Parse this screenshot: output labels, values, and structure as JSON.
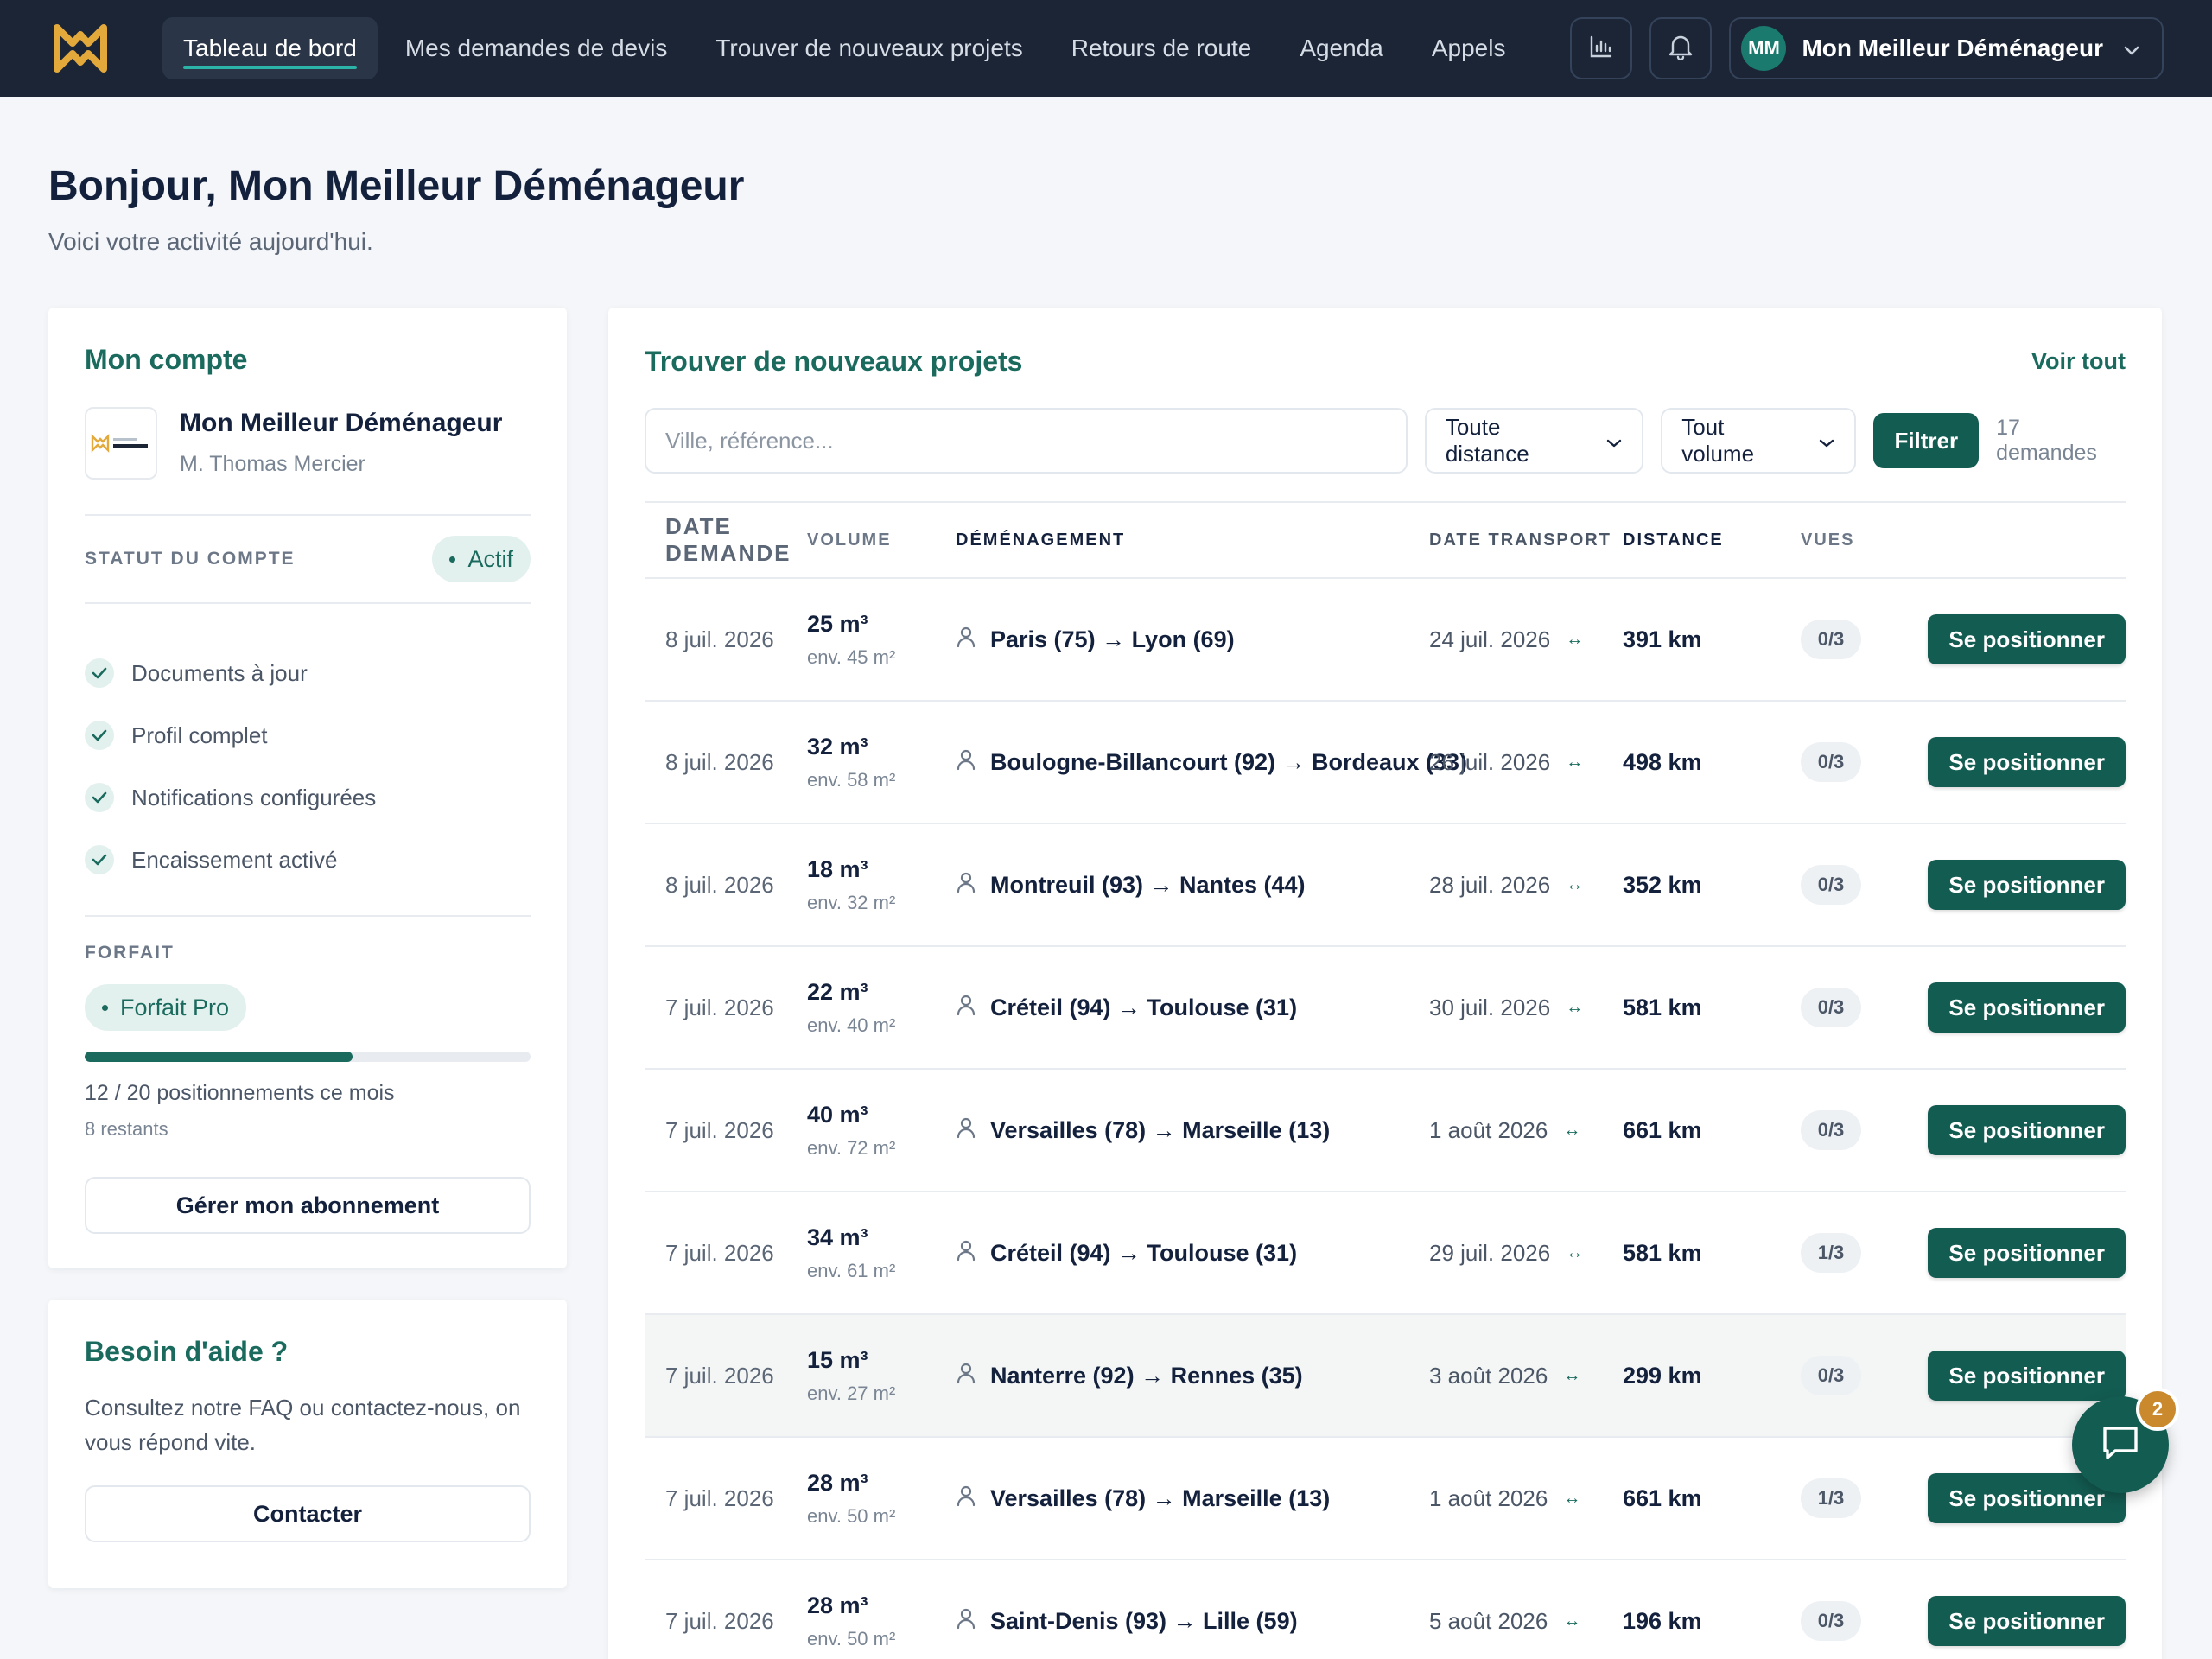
{
  "nav": {
    "items": [
      {
        "label": "Tableau de bord",
        "active": true
      },
      {
        "label": "Mes demandes de devis",
        "active": false
      },
      {
        "label": "Trouver de nouveaux projets",
        "active": false
      },
      {
        "label": "Retours de route",
        "active": false
      },
      {
        "label": "Agenda",
        "active": false
      },
      {
        "label": "Appels",
        "active": false
      }
    ],
    "user_initials": "MM",
    "user_name": "Mon Meilleur Déménageur"
  },
  "greeting": {
    "title": "Bonjour, Mon Meilleur Déménageur",
    "subtitle": "Voici votre activité aujourd'hui."
  },
  "account": {
    "title": "Mon compte",
    "company_name": "Mon Meilleur Déménageur",
    "logo_text": "Mon Meilleur Déménageur",
    "contact": "M. Thomas Mercier",
    "status_label": "STATUT DU COMPTE",
    "status_value": "Actif",
    "checklist": [
      "Documents à jour",
      "Profil complet",
      "Notifications configurées",
      "Encaissement activé"
    ],
    "plan_label": "FORFAIT",
    "plan_name": "Forfait Pro",
    "plan_progress": 0.6,
    "usage": "12 / 20 positionnements ce mois",
    "remaining": "8 restants",
    "manage_button": "Gérer mon abonnement"
  },
  "help": {
    "title": "Besoin d'aide ?",
    "text": "Consultez notre FAQ ou contactez-nous, on vous répond vite.",
    "button": "Contacter"
  },
  "projects": {
    "title": "Trouver de nouveaux projets",
    "see_all": "Voir tout",
    "search_placeholder": "Ville, référence...",
    "distance_filter": "Toute distance",
    "volume_filter": "Tout volume",
    "filter_button": "Filtrer",
    "count": "17 demandes",
    "columns": [
      "DATE DEMANDE",
      "VOLUME",
      "DÉMÉNAGEMENT",
      "DATE TRANSPORT",
      "DISTANCE",
      "VUES"
    ],
    "action_label": "Se positionner",
    "rows": [
      {
        "date": "8 juil. 2026",
        "volume": "25 m³",
        "surface": "env. 45 m²",
        "route": "Paris (75) → Lyon (69)",
        "transport": "24 juil. 2026",
        "distance": "391 km",
        "views": "0/3"
      },
      {
        "date": "8 juil. 2026",
        "volume": "32 m³",
        "surface": "env. 58 m²",
        "route": "Boulogne-Billancourt (92) → Bordeaux (33)",
        "transport": "26 juil. 2026",
        "distance": "498 km",
        "views": "0/3"
      },
      {
        "date": "8 juil. 2026",
        "volume": "18 m³",
        "surface": "env. 32 m²",
        "route": "Montreuil (93) → Nantes (44)",
        "transport": "28 juil. 2026",
        "distance": "352 km",
        "views": "0/3"
      },
      {
        "date": "7 juil. 2026",
        "volume": "22 m³",
        "surface": "env. 40 m²",
        "route": "Créteil (94) → Toulouse (31)",
        "transport": "30 juil. 2026",
        "distance": "581 km",
        "views": "0/3"
      },
      {
        "date": "7 juil. 2026",
        "volume": "40 m³",
        "surface": "env. 72 m²",
        "route": "Versailles (78) → Marseille (13)",
        "transport": "1 août 2026",
        "distance": "661 km",
        "views": "0/3"
      },
      {
        "date": "7 juil. 2026",
        "volume": "34 m³",
        "surface": "env. 61 m²",
        "route": "Créteil (94) → Toulouse (31)",
        "transport": "29 juil. 2026",
        "distance": "581 km",
        "views": "1/3"
      },
      {
        "date": "7 juil. 2026",
        "volume": "15 m³",
        "surface": "env. 27 m²",
        "route": "Nanterre (92) → Rennes (35)",
        "transport": "3 août 2026",
        "distance": "299 km",
        "views": "0/3"
      },
      {
        "date": "7 juil. 2026",
        "volume": "28 m³",
        "surface": "env. 50 m²",
        "route": "Versailles (78) → Marseille (13)",
        "transport": "1 août 2026",
        "distance": "661 km",
        "views": "1/3"
      },
      {
        "date": "7 juil. 2026",
        "volume": "28 m³",
        "surface": "env. 50 m²",
        "route": "Saint-Denis (93) → Lille (59)",
        "transport": "5 août 2026",
        "distance": "196 km",
        "views": "0/3"
      }
    ]
  },
  "chat": {
    "badge": "2"
  },
  "colors": {
    "nav_bg": "#1b2536",
    "accent": "#135c52",
    "accent_text": "#1a6a5e",
    "badge": "#c9892c"
  }
}
